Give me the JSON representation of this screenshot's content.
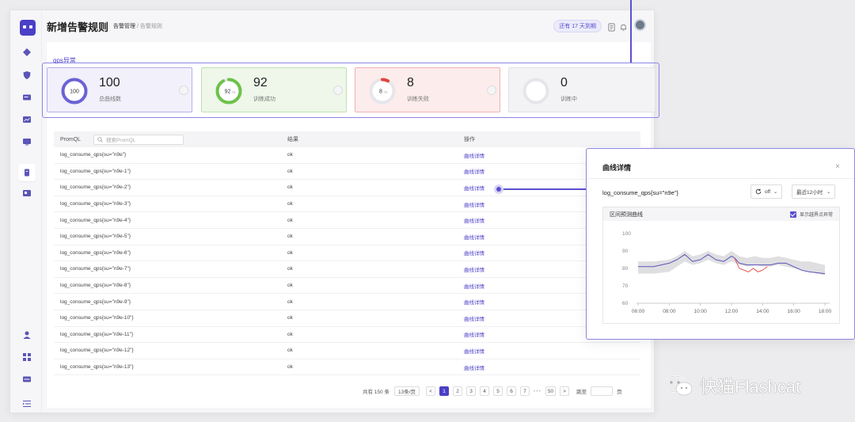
{
  "header": {
    "title": "新增告警规则",
    "breadcrumb_first": "告警管理",
    "breadcrumb_sep": "/",
    "breadcrumb_current": "告警规则",
    "expire_badge": "还有 17 天到期"
  },
  "section_title": "qps异常",
  "stats": [
    {
      "ring_label": "100",
      "value": "100",
      "label": "总曲线数",
      "color": "#6b62d4",
      "fraction": 1.0
    },
    {
      "ring_label": "92",
      "ring_unit": "ms",
      "value": "92",
      "label": "训练成功",
      "color": "#6cc24a",
      "fraction": 0.92
    },
    {
      "ring_label": "8",
      "ring_unit": "ms",
      "value": "8",
      "label": "训练失败",
      "color": "#e0453d",
      "fraction": 0.08
    },
    {
      "ring_label": "",
      "value": "0",
      "label": "训练中",
      "color": "#cccccc",
      "fraction": 0.0
    }
  ],
  "table": {
    "headers": {
      "promql": "PromQL",
      "result": "结果",
      "action": "操作"
    },
    "search_placeholder": "搜索PromQL",
    "rows": [
      {
        "promql": "log_consume_qps{su=\"n9e\"}",
        "result": "ok",
        "action": "曲线详情"
      },
      {
        "promql": "log_consume_qps{su=\"n9e-1\"}",
        "result": "ok",
        "action": "曲线详情"
      },
      {
        "promql": "log_consume_qps{su=\"n9e-2\"}",
        "result": "ok",
        "action": "曲线详情"
      },
      {
        "promql": "log_consume_qps{su=\"n9e-3\"}",
        "result": "ok",
        "action": "曲线详情"
      },
      {
        "promql": "log_consume_qps{su=\"n9e-4\"}",
        "result": "ok",
        "action": "曲线详情"
      },
      {
        "promql": "log_consume_qps{su=\"n9e-5\"}",
        "result": "ok",
        "action": "曲线详情"
      },
      {
        "promql": "log_consume_qps{su=\"n9e-6\"}",
        "result": "ok",
        "action": "曲线详情"
      },
      {
        "promql": "log_consume_qps{su=\"n9e-7\"}",
        "result": "ok",
        "action": "曲线详情"
      },
      {
        "promql": "log_consume_qps{su=\"n9e-8\"}",
        "result": "ok",
        "action": "曲线详情"
      },
      {
        "promql": "log_consume_qps{su=\"n9e-9\"}",
        "result": "ok",
        "action": "曲线详情"
      },
      {
        "promql": "log_consume_qps{su=\"n9e-10\"}",
        "result": "ok",
        "action": "曲线详情"
      },
      {
        "promql": "log_consume_qps{su=\"n9e-11\"}",
        "result": "ok",
        "action": "曲线详情"
      },
      {
        "promql": "log_consume_qps{su=\"n9e-12\"}",
        "result": "ok",
        "action": "曲线详情"
      },
      {
        "promql": "log_consume_qps{su=\"n9e-13\"}",
        "result": "ok",
        "action": "曲线详情"
      }
    ]
  },
  "pagination": {
    "total": "共有 150 条",
    "page_size": "13条/页",
    "prev": "<",
    "pages": [
      "1",
      "2",
      "3",
      "4",
      "5",
      "6",
      "7"
    ],
    "ellipsis": "•••",
    "last": "50",
    "next": ">",
    "goto_label": "跳至",
    "goto_suffix": "页",
    "current": "1"
  },
  "panel": {
    "title": "曲线详情",
    "close": "×",
    "metric": "log_consume_qps{su=\"n9e\"}",
    "refresh_value": "off",
    "time_range": "最近12小时",
    "chart_title": "区间预测曲线",
    "checkbox_label": "显示越界点异常"
  },
  "chart_data": {
    "type": "line",
    "title": "区间预测曲线",
    "x_ticks": [
      "06:00",
      "08:00",
      "10:00",
      "12:00",
      "14:00",
      "16:00",
      "18:00"
    ],
    "y_ticks": [
      60,
      70,
      80,
      90,
      100
    ],
    "ylim": [
      60,
      100
    ],
    "xlim": [
      6,
      18
    ],
    "series": [
      {
        "kind": "band",
        "color": "#d4d4d8",
        "x": [
          6,
          7,
          8,
          8.5,
          9,
          9.5,
          10,
          10.5,
          11,
          11.5,
          12,
          12.5,
          13,
          13.5,
          14,
          14.5,
          15,
          15.5,
          16,
          16.5,
          17,
          17.5,
          18
        ],
        "upper": [
          84,
          84,
          85,
          87,
          90,
          87,
          88,
          90,
          88,
          87,
          90,
          87,
          86,
          87,
          86,
          86,
          87,
          86,
          85,
          84,
          84,
          83,
          82
        ],
        "lower": [
          77,
          77,
          78,
          81,
          84,
          82,
          83,
          85,
          83,
          82,
          84,
          82,
          81,
          82,
          81,
          81,
          82,
          81,
          80,
          79,
          78,
          77,
          76
        ]
      },
      {
        "kind": "line",
        "color": "#5b55b8",
        "x": [
          6,
          7,
          8,
          8.5,
          9,
          9.5,
          10,
          10.5,
          11,
          11.5,
          12,
          12.2,
          12.5,
          13,
          13.5,
          14,
          14.5,
          15,
          15.5,
          16,
          16.5,
          17,
          18
        ],
        "y": [
          81,
          81,
          83,
          85,
          88,
          84,
          85,
          88,
          85,
          84,
          87,
          86,
          83,
          82,
          82,
          82,
          82,
          83,
          83,
          81,
          79,
          78,
          77
        ]
      },
      {
        "kind": "anomaly",
        "color": "#e0453d",
        "x": [
          12.2,
          12.5,
          12.8,
          13.1,
          13.4,
          13.7,
          14.0,
          14.3
        ],
        "y": [
          86,
          80,
          79,
          78,
          80,
          78,
          79,
          81
        ]
      }
    ]
  },
  "watermark": "快猫Flashcat"
}
